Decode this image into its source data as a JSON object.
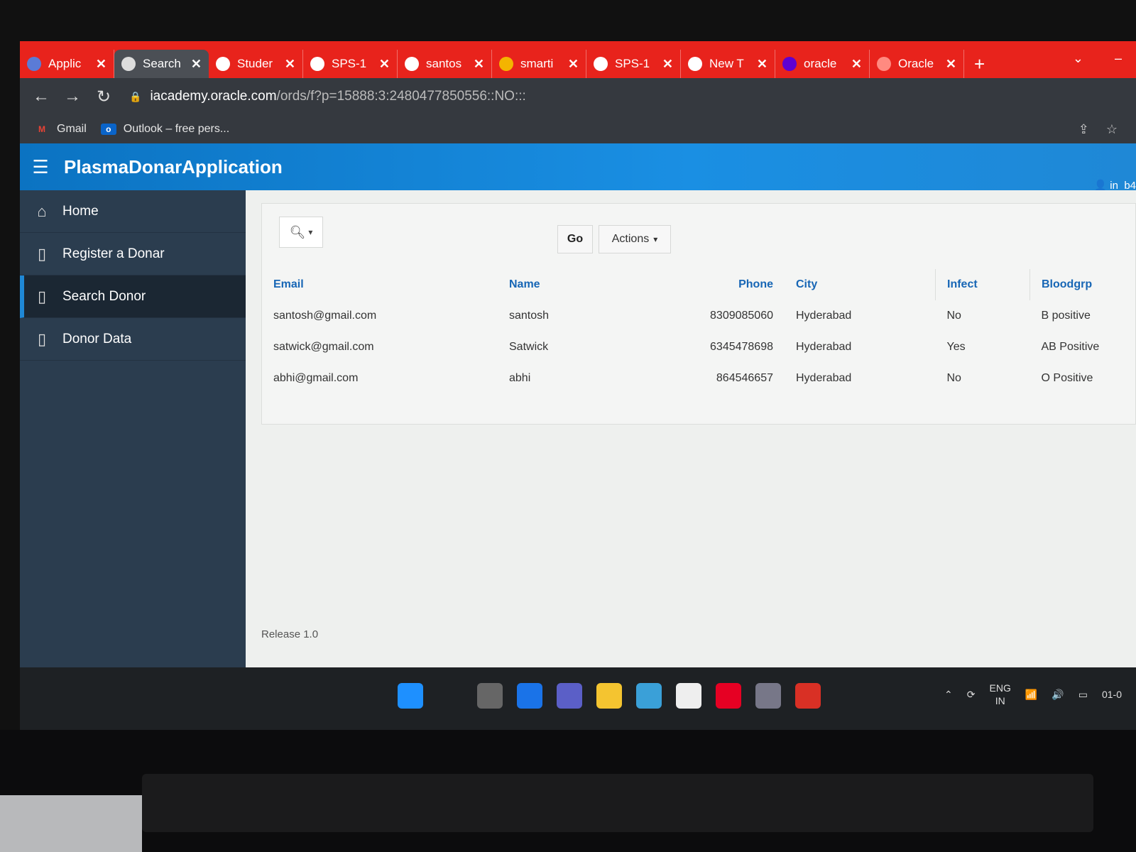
{
  "browser": {
    "tabs": [
      {
        "label": "Applic",
        "icon": "x-app-icon",
        "color": "#5b7bd6"
      },
      {
        "label": "Search",
        "icon": "page-icon",
        "color": "#ddd",
        "active": true
      },
      {
        "label": "Studer",
        "icon": "globe-icon",
        "color": "#fff"
      },
      {
        "label": "SPS-1",
        "icon": "form-icon",
        "color": "#fff"
      },
      {
        "label": "santos",
        "icon": "github-icon",
        "color": "#fff"
      },
      {
        "label": "smarti",
        "icon": "chart-icon",
        "color": "#f4b400"
      },
      {
        "label": "SPS-1",
        "icon": "github-icon",
        "color": "#fff"
      },
      {
        "label": "New T",
        "icon": "globe-icon",
        "color": "#fff"
      },
      {
        "label": "oracle",
        "icon": "yahoo-icon",
        "color": "#5f01d1"
      },
      {
        "label": "Oracle",
        "icon": "oracle-icon",
        "color": "#ff8a80"
      }
    ],
    "tab_close_glyph": "✕",
    "new_tab_glyph": "+",
    "url_host": "iacademy.oracle.com",
    "url_path": "/ords/f?p=15888:3:2480477850556::NO:::",
    "bookmarks": [
      {
        "label": "Gmail",
        "icon": "gmail-icon"
      },
      {
        "label": "Outlook – free pers...",
        "icon": "outlook-icon"
      }
    ]
  },
  "app": {
    "title": "PlasmaDonarApplication",
    "user": "in_b4",
    "nav": [
      {
        "label": "Home",
        "icon": "home-icon"
      },
      {
        "label": "Register a Donar",
        "icon": "document-icon"
      },
      {
        "label": "Search Donor",
        "icon": "document-icon",
        "active": true
      },
      {
        "label": "Donor Data",
        "icon": "document-icon"
      }
    ]
  },
  "report": {
    "go_label": "Go",
    "actions_label": "Actions",
    "columns": [
      "Email",
      "Name",
      "Phone",
      "City",
      "Infect",
      "Bloodgrp"
    ],
    "rows": [
      [
        "santosh@gmail.com",
        "santosh",
        "8309085060",
        "Hyderabad",
        "No",
        "B positive"
      ],
      [
        "satwick@gmail.com",
        "Satwick",
        "6345478698",
        "Hyderabad",
        "Yes",
        "AB Positive"
      ],
      [
        "abhi@gmail.com",
        "abhi",
        "864546657",
        "Hyderabad",
        "No",
        "O Positive"
      ]
    ],
    "footer": "Release 1.0"
  },
  "taskbar": {
    "apps": [
      "windows-start-icon",
      "search-icon",
      "task-view-icon",
      "widgets-icon",
      "teams-icon",
      "file-explorer-icon",
      "notepad-icon",
      "store-icon",
      "pinterest-icon",
      "camera-icon",
      "chrome-icon"
    ],
    "lang_top": "ENG",
    "lang_bottom": "IN",
    "clock": "01-0"
  }
}
